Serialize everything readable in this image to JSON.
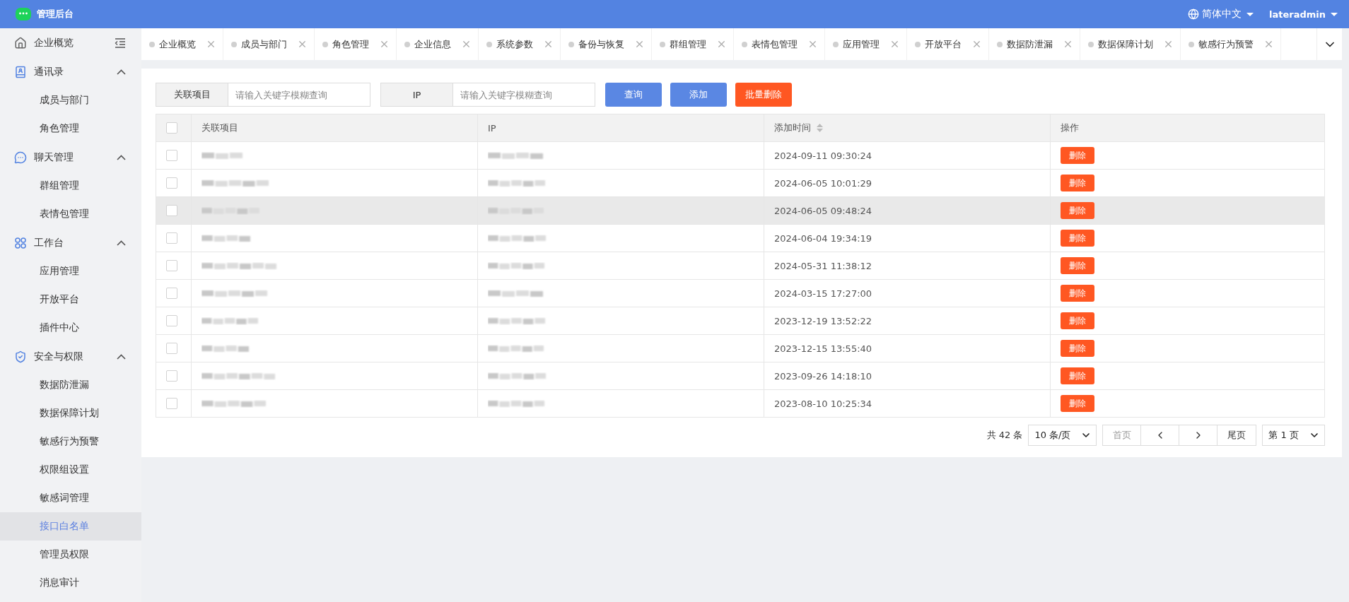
{
  "header": {
    "title": "管理后台",
    "language": "简体中文",
    "user": "lateradmin"
  },
  "sidebar": {
    "items": [
      {
        "kind": "link",
        "label": "企业概览",
        "selected": false
      },
      {
        "kind": "group",
        "label": "通讯录",
        "expanded": true,
        "children": [
          {
            "label": "成员与部门",
            "selected": false
          },
          {
            "label": "角色管理",
            "selected": false
          }
        ]
      },
      {
        "kind": "group",
        "label": "聊天管理",
        "expanded": true,
        "children": [
          {
            "label": "群组管理",
            "selected": false
          },
          {
            "label": "表情包管理",
            "selected": false
          }
        ]
      },
      {
        "kind": "group",
        "label": "工作台",
        "expanded": true,
        "children": [
          {
            "label": "应用管理",
            "selected": false
          },
          {
            "label": "开放平台",
            "selected": false
          },
          {
            "label": "插件中心",
            "selected": false
          }
        ]
      },
      {
        "kind": "group",
        "label": "安全与权限",
        "expanded": true,
        "children": [
          {
            "label": "数据防泄漏",
            "selected": false
          },
          {
            "label": "数据保障计划",
            "selected": false
          },
          {
            "label": "敏感行为预警",
            "selected": false
          },
          {
            "label": "权限组设置",
            "selected": false
          },
          {
            "label": "敏感词管理",
            "selected": false
          },
          {
            "label": "接口白名单",
            "selected": true
          },
          {
            "label": "管理员权限",
            "selected": false
          },
          {
            "label": "消息审计",
            "selected": false
          }
        ]
      }
    ]
  },
  "tabs": [
    {
      "label": "企业概览",
      "selected": false
    },
    {
      "label": "成员与部门",
      "selected": false
    },
    {
      "label": "角色管理",
      "selected": false
    },
    {
      "label": "企业信息",
      "selected": false
    },
    {
      "label": "系统参数",
      "selected": false
    },
    {
      "label": "备份与恢复",
      "selected": false
    },
    {
      "label": "群组管理",
      "selected": false
    },
    {
      "label": "表情包管理",
      "selected": false
    },
    {
      "label": "应用管理",
      "selected": false
    },
    {
      "label": "开放平台",
      "selected": false
    },
    {
      "label": "数据防泄漏",
      "selected": false
    },
    {
      "label": "数据保障计划",
      "selected": false
    },
    {
      "label": "敏感行为预警",
      "selected": false
    }
  ],
  "filters": [
    {
      "label": "关联项目",
      "placeholder": "请输入关键字模糊查询"
    },
    {
      "label": "IP",
      "placeholder": "请输入关键字模糊查询"
    }
  ],
  "buttons": [
    {
      "label": "查询",
      "kind": "primary"
    },
    {
      "label": "添加",
      "kind": "primary"
    },
    {
      "label": "批量删除",
      "kind": "danger"
    }
  ],
  "table": {
    "select_all": {
      "checked": false
    },
    "columns": [
      "关联项目",
      "IP",
      "添加时间",
      "操作"
    ],
    "rows": [
      {
        "checked": false,
        "hovered": false,
        "project": {
          "kind": "redacted"
        },
        "ip": {
          "kind": "redacted"
        },
        "time": "2024-09-11 09:30:24",
        "action": "删除"
      },
      {
        "checked": false,
        "hovered": false,
        "project": {
          "kind": "redacted"
        },
        "ip": {
          "kind": "redacted"
        },
        "time": "2024-06-05 10:01:29",
        "action": "删除"
      },
      {
        "checked": false,
        "hovered": true,
        "project": {
          "kind": "redacted"
        },
        "ip": {
          "kind": "redacted"
        },
        "time": "2024-06-05 09:48:24",
        "action": "删除"
      },
      {
        "checked": false,
        "hovered": false,
        "project": {
          "kind": "redacted"
        },
        "ip": {
          "kind": "redacted"
        },
        "time": "2024-06-04 19:34:19",
        "action": "删除"
      },
      {
        "checked": false,
        "hovered": false,
        "project": {
          "kind": "redacted"
        },
        "ip": {
          "kind": "redacted"
        },
        "time": "2024-05-31 11:38:12",
        "action": "删除"
      },
      {
        "checked": false,
        "hovered": false,
        "project": {
          "kind": "redacted"
        },
        "ip": {
          "kind": "redacted"
        },
        "time": "2024-03-15 17:27:00",
        "action": "删除"
      },
      {
        "checked": false,
        "hovered": false,
        "project": {
          "kind": "redacted"
        },
        "ip": {
          "kind": "redacted"
        },
        "time": "2023-12-19 13:52:22",
        "action": "删除"
      },
      {
        "checked": false,
        "hovered": false,
        "project": {
          "kind": "redacted"
        },
        "ip": {
          "kind": "redacted"
        },
        "time": "2023-12-15 13:55:40",
        "action": "删除"
      },
      {
        "checked": false,
        "hovered": false,
        "project": {
          "kind": "redacted"
        },
        "ip": {
          "kind": "redacted"
        },
        "time": "2023-09-26 14:18:10",
        "action": "删除"
      },
      {
        "checked": false,
        "hovered": false,
        "project": {
          "kind": "redacted"
        },
        "ip": {
          "kind": "redacted"
        },
        "time": "2023-08-10 10:25:34",
        "action": "删除"
      }
    ]
  },
  "pagination": {
    "total": "共 42 条",
    "page_size": "10 条/页",
    "first": "首页",
    "last": "尾页",
    "page": "第 1 页"
  }
}
